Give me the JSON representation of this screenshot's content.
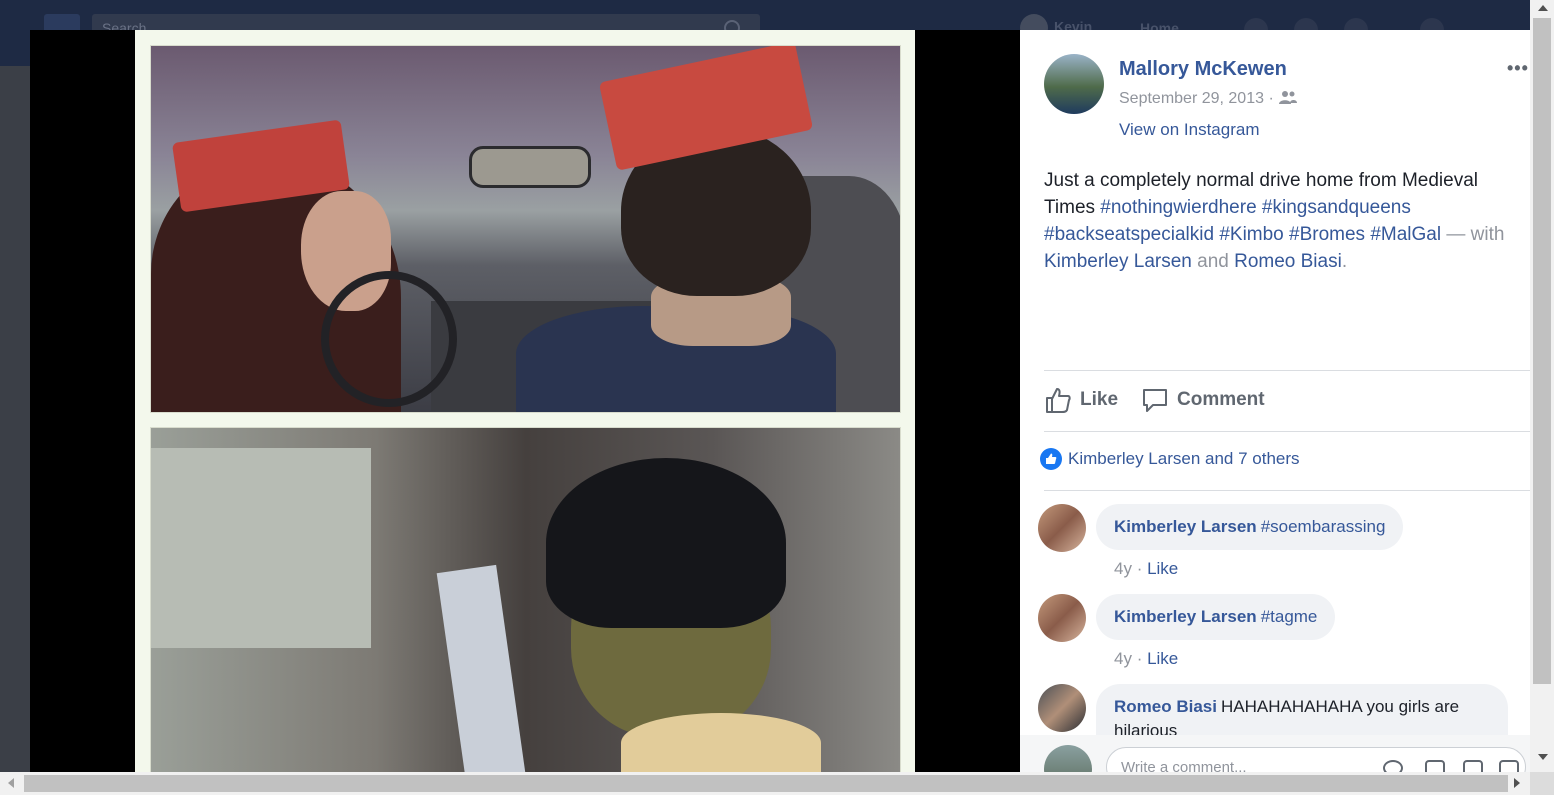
{
  "background": {
    "search_placeholder": "Search",
    "user_label": "Kevin",
    "home_label": "Home"
  },
  "post": {
    "author": "Mallory McKewen",
    "date": "September 29, 2013 · ",
    "audience_icon": "friends-icon",
    "view_on_instagram": "View on Instagram",
    "more_label": "•••",
    "caption": {
      "text": "Just a completely normal drive home from Medieval Times ",
      "hashtags": [
        "#nothingwierdhere",
        "#kingsandqueens",
        "#backseatspecialkid",
        "#Kimbo",
        "#Bromes",
        "#MalGal"
      ],
      "with_prefix": " — with ",
      "tagged": [
        "Kimberley Larsen",
        "Romeo Biasi"
      ],
      "and_word": " and ",
      "end": "."
    }
  },
  "actions": {
    "like": "Like",
    "comment": "Comment"
  },
  "reactions": {
    "summary": "Kimberley Larsen and 7 others"
  },
  "comments": [
    {
      "author": "Kimberley Larsen",
      "text": "#soembarassing",
      "age": "4y",
      "like": "Like"
    },
    {
      "author": "Kimberley Larsen",
      "text": "#tagme",
      "age": "4y",
      "like": "Like"
    },
    {
      "author": "Romeo Biasi",
      "text": "HAHAHAHAHAHA you girls are",
      "text2": "hilarious"
    }
  ],
  "composer": {
    "placeholder": "Write a comment..."
  },
  "colors": {
    "link": "#365899",
    "muted": "#90949c",
    "theater_bg": "#000000"
  }
}
